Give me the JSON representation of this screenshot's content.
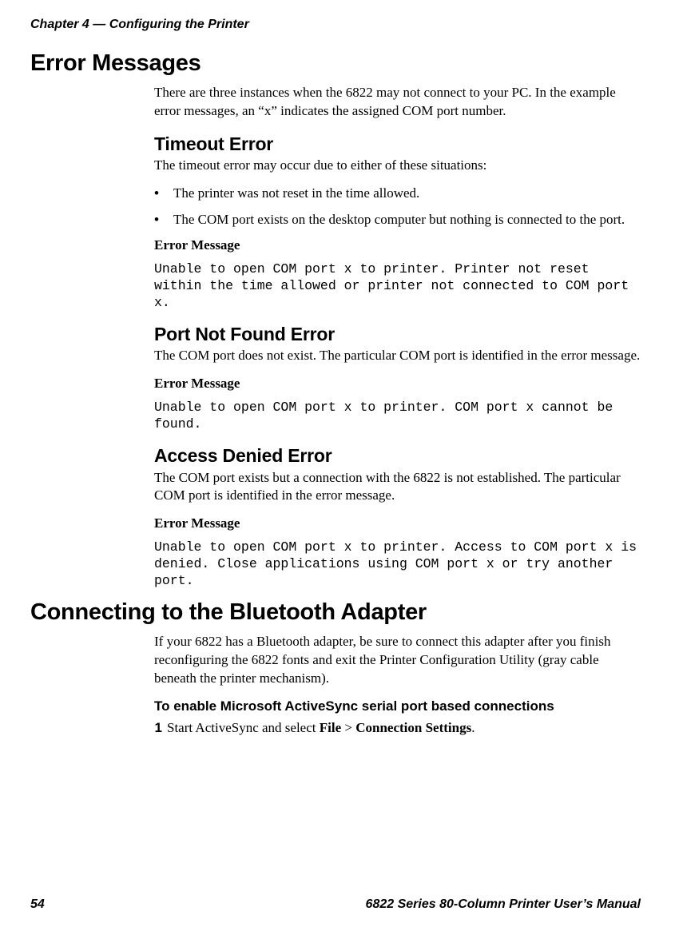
{
  "runningHead": "Chapter 4 — Configuring the Printer",
  "h1_error": "Error Messages",
  "p_intro": "There are three instances when the 6822 may not connect to your PC. In the example error messages, an “x” indicates the assigned COM port number.",
  "timeout": {
    "heading": "Timeout Error",
    "lead": "The timeout error may occur due to either of these situations:",
    "bullet1": "The printer was not reset in the time allowed.",
    "bullet2": "The COM port exists on the desktop computer but nothing is connected to the port.",
    "msgLabel": "Error Message",
    "msg": "Unable to open COM port x to printer. Printer not reset within the time allowed or printer not connected to COM port x."
  },
  "portnotfound": {
    "heading": "Port Not Found Error",
    "lead": "The COM port does not exist. The particular COM port is identified in the error message.",
    "msgLabel": "Error Message",
    "msg": "Unable to open COM port x to printer. COM port x cannot be found."
  },
  "accessdenied": {
    "heading": "Access Denied Error",
    "lead": "The COM port exists but a connection with the 6822 is not established. The particular COM port is identified in the error message.",
    "msgLabel": "Error Message",
    "msg": "Unable to open COM port x to printer. Access to COM port x is denied. Close applications using COM port x or try another port."
  },
  "h1_bt": "Connecting to the Bluetooth Adapter",
  "bt_lead": "If your 6822 has a Bluetooth adapter, be sure to connect this adapter after you finish reconfiguring the 6822 fonts and exit the Printer Configuration Utility (gray cable beneath the printer mechanism).",
  "bt_proc_head": "To enable Microsoft ActiveSync serial port based connections",
  "step1_pre": "Start ActiveSync and select ",
  "step1_bold1": "File",
  "step1_mid": " > ",
  "step1_bold2": "Connection Settings",
  "step1_post": ".",
  "bulletChar": "•",
  "stepNum1": "1",
  "footer": {
    "pageNum": "54",
    "manual": "6822 Series 80-Column Printer User’s Manual"
  }
}
